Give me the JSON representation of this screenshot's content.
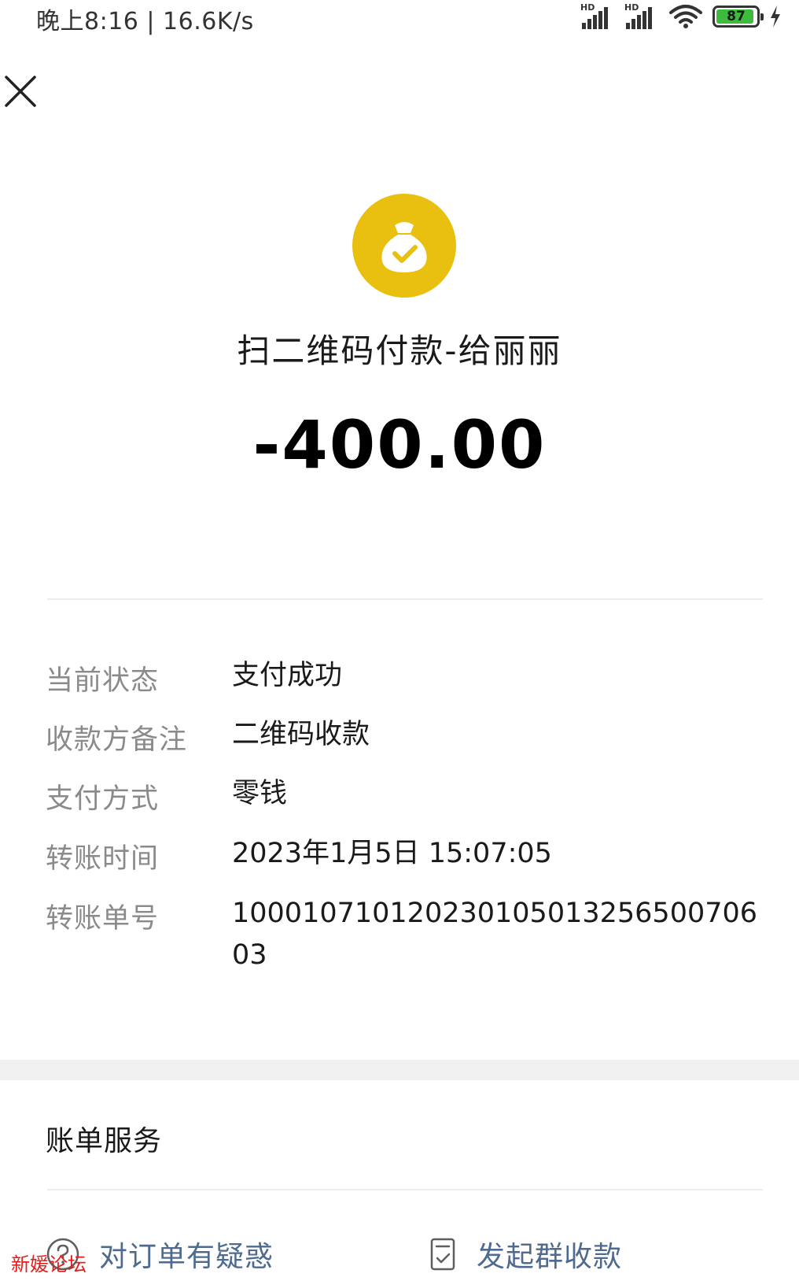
{
  "status_bar": {
    "time_speed": "晚上8:16 | 16.6K/s",
    "signal1_label": "HD",
    "signal2_label": "HD",
    "battery_level": "87",
    "icons": [
      "signal-icon",
      "signal-icon",
      "wifi-icon",
      "battery-icon",
      "charging-icon"
    ]
  },
  "header": {
    "close_icon": "close-icon"
  },
  "transaction": {
    "icon": "money-bag-check-icon",
    "icon_color": "#E9C00F",
    "payee": "扫二维码付款-给丽丽",
    "amount": "-400.00"
  },
  "details": [
    {
      "label": "当前状态",
      "value": "支付成功"
    },
    {
      "label": "收款方备注",
      "value": "二维码收款"
    },
    {
      "label": "支付方式",
      "value": "零钱"
    },
    {
      "label": "转账时间",
      "value": "2023年1月5日 15:07:05"
    },
    {
      "label": "转账单号",
      "value": "10001071012023010501325650070603"
    }
  ],
  "bill_services": {
    "title": "账单服务",
    "actions": [
      {
        "label": "对订单有疑惑",
        "icon": "question-circle-icon"
      },
      {
        "label": "发起群收款",
        "icon": "document-check-icon"
      }
    ],
    "link_color": "#4F6A8F"
  },
  "watermark": "新媛论坛"
}
